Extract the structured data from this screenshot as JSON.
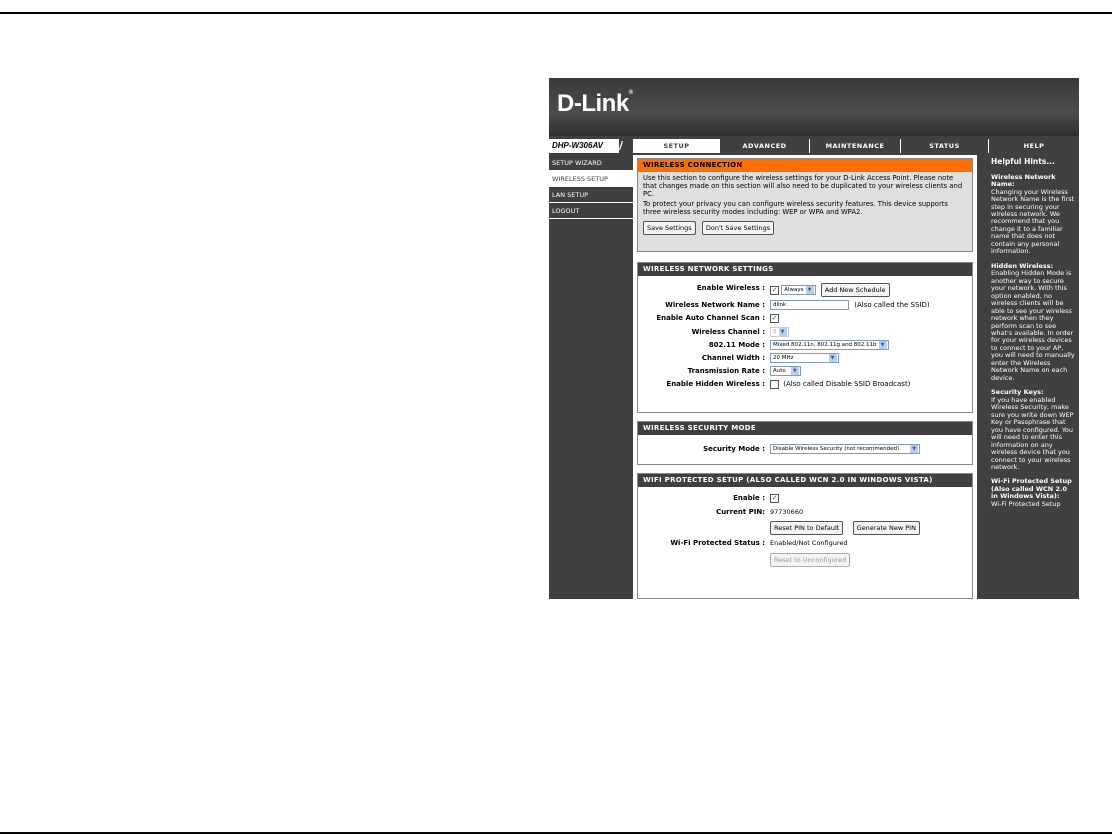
{
  "device": {
    "brand": "D-Link",
    "model": "DHP-W306AV"
  },
  "tabs": [
    {
      "label": "SETUP",
      "active": true
    },
    {
      "label": "ADVANCED",
      "active": false
    },
    {
      "label": "MAINTENANCE",
      "active": false
    },
    {
      "label": "STATUS",
      "active": false
    },
    {
      "label": "HELP",
      "active": false
    }
  ],
  "sidebar": {
    "items": [
      {
        "label": "SETUP WIZARD",
        "active": false
      },
      {
        "label": "WIRELESS SETUP",
        "active": true
      },
      {
        "label": "LAN SETUP",
        "active": false
      },
      {
        "label": "LOGOUT",
        "active": false
      }
    ]
  },
  "intro": {
    "title": "WIRELESS CONNECTION",
    "text1": "Use this section to configure the wireless settings for your D-Link Access Point. Please note that changes made on this section will also need to be duplicated to your wireless clients and PC.",
    "text2": "To protect your privacy you can configure wireless security features. This device supports three wireless security modes including: WEP or WPA and WPA2.",
    "save_label": "Save Settings",
    "dont_save_label": "Don't Save Settings"
  },
  "wireless": {
    "title": "WIRELESS NETWORK SETTINGS",
    "enable_label": "Enable Wireless :",
    "enable_checked": true,
    "schedule_value": "Always",
    "add_schedule_label": "Add New Schedule",
    "ssid_label": "Wireless Network Name :",
    "ssid_value": "dlink",
    "ssid_note": "(Also called the SSID)",
    "auto_channel_label": "Enable Auto Channel Scan :",
    "auto_channel_checked": true,
    "channel_label": "Wireless Channel :",
    "channel_value": "6",
    "mode_label": "802.11 Mode :",
    "mode_value": "Mixed 802.11n, 802.11g and 802.11b",
    "width_label": "Channel Width :",
    "width_value": "20 MHz",
    "rate_label": "Transmission Rate :",
    "rate_value": "Auto",
    "hidden_label": "Enable Hidden Wireless :",
    "hidden_checked": false,
    "hidden_note": "(Also called Disable SSID Broadcast)"
  },
  "security": {
    "title": "WIRELESS SECURITY MODE",
    "mode_label": "Security Mode :",
    "mode_value": "Disable Wireless Security (not recommended)"
  },
  "wps": {
    "title": "WIFI PROTECTED SETUP (ALSO CALLED WCN 2.0 IN WINDOWS VISTA)",
    "enable_label": "Enable :",
    "enable_checked": true,
    "pin_label": "Current PIN:",
    "pin_value": "97730660",
    "reset_pin_label": "Reset PIN to Default",
    "generate_pin_label": "Generate New PIN",
    "status_label": "Wi-Fi Protected Status :",
    "status_value": "Enabled/Not Configured",
    "reset_unconfigured_label": "Reset to Unconfigured"
  },
  "help": {
    "title": "Helpful Hints...",
    "h1": "Wireless Network Name:",
    "p1": "Changing your Wireless Network Name is the first step in securing your wireless network. We recommend that you change it to a familiar name that does not contain any personal information.",
    "h2": "Hidden Wireless:",
    "p2": "Enabling Hidden Mode is another way to secure your network. With this option enabled, no wireless clients will be able to see your wireless network when they perform scan to see what's available. In order for your wireless devices to connect to your AP, you will need to manually enter the Wireless Network Name on each device.",
    "h3": "Security Keys:",
    "p3": "If you have enabled Wireless Security, make sure you write down WEP Key or Passphrase that you have configured. You will need to enter this information on any wireless device that you connect to your wireless network.",
    "h4": "Wi-Fi Protected Setup (Also called WCN 2.0 in Windows Vista):",
    "p4": "Wi-Fi Protected Setup"
  },
  "colors": {
    "accent_orange": "#ff6f00",
    "dark_gray": "#404040"
  }
}
